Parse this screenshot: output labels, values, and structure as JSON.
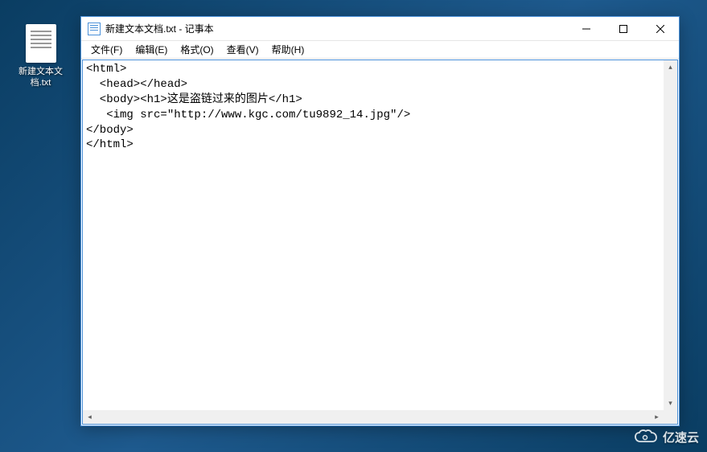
{
  "desktop": {
    "icon_label": "新建文本文档.txt"
  },
  "window": {
    "title": "新建文本文档.txt - 记事本"
  },
  "menu": {
    "file": "文件(F)",
    "edit": "编辑(E)",
    "format": "格式(O)",
    "view": "查看(V)",
    "help": "帮助(H)"
  },
  "editor": {
    "content": "<html>\n  <head></head>\n  <body><h1>这是盗链过来的图片</h1>\n   <img src=\"http://www.kgc.com/tu9892_14.jpg\"/>\n</body>\n</html>"
  },
  "watermark": {
    "text": "亿速云"
  }
}
